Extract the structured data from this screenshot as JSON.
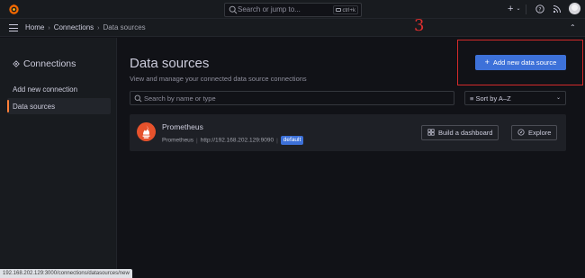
{
  "topbar": {
    "search_placeholder": "Search or jump to...",
    "search_shortcut": "ctrl+k",
    "new_label": "+"
  },
  "breadcrumb": {
    "items": [
      "Home",
      "Connections",
      "Data sources"
    ]
  },
  "annotation": {
    "step_number": "3",
    "color": "#e02f2f"
  },
  "sidebar": {
    "title": "Connections",
    "items": [
      {
        "label": "Add new connection",
        "active": false
      },
      {
        "label": "Data sources",
        "active": true
      }
    ]
  },
  "main": {
    "title": "Data sources",
    "subtitle": "View and manage your connected data source connections",
    "add_button": "Add new data source",
    "filter_placeholder": "Search by name or type",
    "sort_label": "Sort by A–Z",
    "datasources": [
      {
        "name": "Prometheus",
        "type": "Prometheus",
        "url": "http://192.168.202.129:9090",
        "badge": "default",
        "actions": [
          "Build a dashboard",
          "Explore"
        ]
      }
    ]
  },
  "status_url": "192.168.202.129:3000/connections/datasources/new",
  "colors": {
    "accent": "#3d71d9",
    "background": "#111217",
    "panel": "#181b1f",
    "active_indicator": "#ff7f38",
    "prometheus": "#e6522c"
  }
}
